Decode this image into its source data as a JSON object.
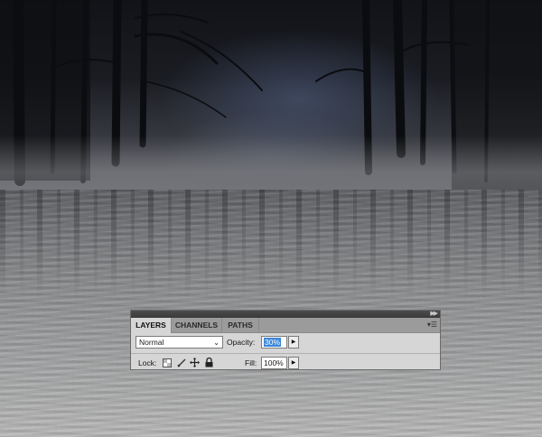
{
  "panel": {
    "tabs": [
      {
        "label": "LAYERS",
        "active": true
      },
      {
        "label": "CHANNELS",
        "active": false
      },
      {
        "label": "PATHS",
        "active": false
      }
    ],
    "blend_mode": "Normal",
    "opacity_label": "Opacity:",
    "opacity_value": "30%",
    "lock_label": "Lock:",
    "fill_label": "Fill:",
    "fill_value": "100%"
  },
  "icons": {
    "collapse": "double-chevron-right-icon",
    "panel_menu": "panel-menu-icon",
    "blend_dropdown": "chevron-down-icon",
    "lock_transparent": "lock-transparent-pixels-icon",
    "lock_image": "brush-icon",
    "lock_position": "move-icon",
    "lock_all": "padlock-icon"
  },
  "colors": {
    "panel_bg": "#d6d6d6",
    "tabbar_bg": "#9b9b9b",
    "selection": "#3d86d8"
  }
}
